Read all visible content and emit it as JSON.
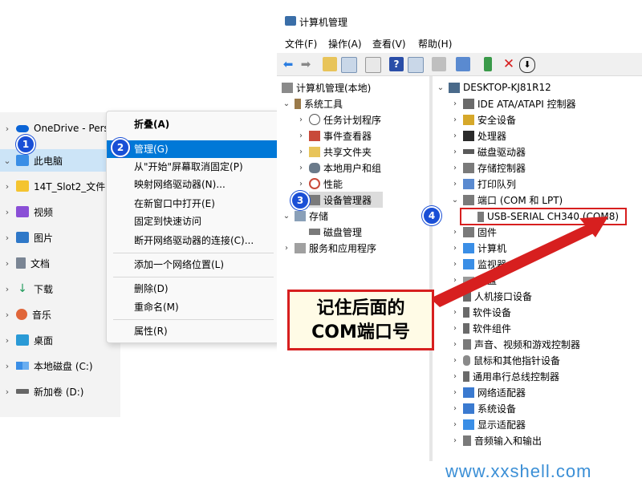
{
  "explorer": {
    "items": [
      {
        "label": "OneDrive - Pers",
        "icon": "cloud-icon",
        "color": "#0a64d6"
      },
      {
        "label": "此电脑",
        "icon": "computer-icon",
        "color": "#3a8ee6"
      },
      {
        "label": "14T_Slot2_文件",
        "icon": "folder-icon",
        "color": "#f4c430"
      },
      {
        "label": "视频",
        "icon": "video-icon",
        "color": "#8a4fd6"
      },
      {
        "label": "图片",
        "icon": "picture-icon",
        "color": "#2f78c8"
      },
      {
        "label": "文档",
        "icon": "document-icon",
        "color": "#7a8594"
      },
      {
        "label": "下载",
        "icon": "download-icon",
        "color": "#1f9a5a"
      },
      {
        "label": "音乐",
        "icon": "music-icon",
        "color": "#e0663a"
      },
      {
        "label": "桌面",
        "icon": "desktop-icon",
        "color": "#2a9ad6"
      },
      {
        "label": "本地磁盘 (C:)",
        "icon": "drive-windows-icon",
        "color": "#3a8ee6"
      },
      {
        "label": "新加卷 (D:)",
        "icon": "drive-icon",
        "color": "#666666"
      }
    ]
  },
  "context_menu": {
    "items": [
      "折叠(A)",
      "管理(G)",
      "从\"开始\"屏幕取消固定(P)",
      "映射网络驱动器(N)...",
      "在新窗口中打开(E)",
      "固定到快速访问",
      "断开网络驱动器的连接(C)...",
      "添加一个网络位置(L)",
      "删除(D)",
      "重命名(M)",
      "属性(R)"
    ]
  },
  "mmc": {
    "title": "计算机管理",
    "menu": [
      "文件(F)",
      "操作(A)",
      "查看(V)",
      "帮助(H)"
    ],
    "left_tree": [
      "计算机管理(本地)",
      "系统工具",
      "任务计划程序",
      "事件查看器",
      "共享文件夹",
      "本地用户和组",
      "性能",
      "设备管理器",
      "存储",
      "磁盘管理",
      "服务和应用程序"
    ],
    "right_tree": {
      "root": "DESKTOP-KJ81R12",
      "items": [
        "IDE ATA/ATAPI 控制器",
        "安全设备",
        "处理器",
        "磁盘驱动器",
        "存储控制器",
        "打印队列",
        "端口 (COM 和 LPT)",
        "USB-SERIAL CH340 (COM8)",
        "固件",
        "计算机",
        "监视器",
        "键盘",
        "人机接口设备",
        "软件设备",
        "软件组件",
        "声音、视频和游戏控制器",
        "鼠标和其他指针设备",
        "通用串行总线控制器",
        "网络适配器",
        "系统设备",
        "显示适配器",
        "音频输入和输出"
      ]
    }
  },
  "callout": {
    "line1": "记住后面的",
    "line2": "COM端口号"
  },
  "badges": [
    "1",
    "2",
    "3",
    "4"
  ],
  "watermark": "www.xxshell.com",
  "colors": {
    "highlight_blue": "#0078d7",
    "callout_red": "#d71f1f",
    "badge_blue": "#1a4fd6"
  }
}
